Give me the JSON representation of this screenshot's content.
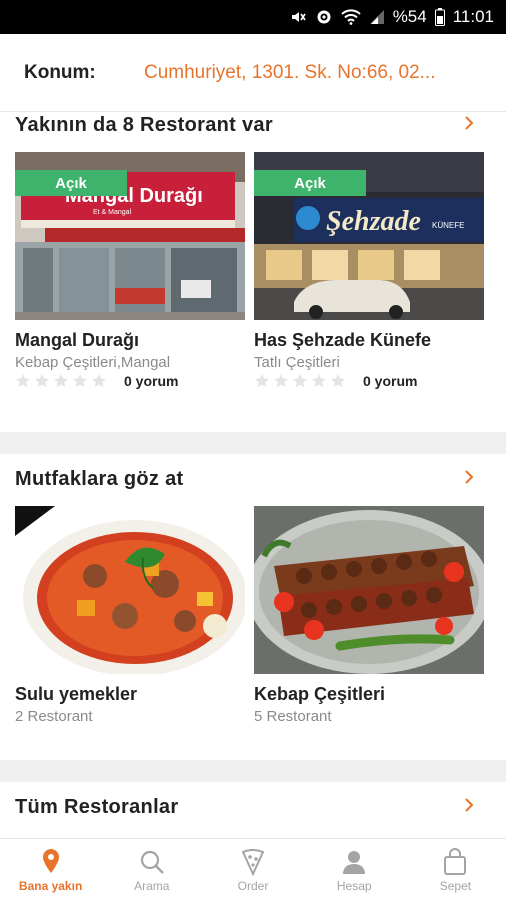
{
  "status_bar": {
    "battery": "%54",
    "time": "11:01"
  },
  "location": {
    "label": "Konum:",
    "value": "Cumhuriyet, 1301. Sk. No:66, 02..."
  },
  "nearby": {
    "title": "Yakının da 8 Restorant var",
    "restaurants": [
      {
        "status": "Açık",
        "name": "Mangal Durağı",
        "category": "Kebap Çeşitleri,Mangal",
        "reviews": "0 yorum",
        "rating": 0,
        "sign_text": "Mangal Durağı"
      },
      {
        "status": "Açık",
        "name": "Has Şehzade Künefe",
        "category": "Tatlı Çeşitleri",
        "reviews": "0 yorum",
        "rating": 0,
        "sign_text": "Şehzade"
      }
    ]
  },
  "cuisines": {
    "title": "Mutfaklara göz at",
    "items": [
      {
        "name": "Sulu yemekler",
        "count": "2 Restorant"
      },
      {
        "name": "Kebap Çeşitleri",
        "count": "5 Restorant"
      }
    ]
  },
  "all_restaurants": {
    "title": "Tüm Restoranlar"
  },
  "bottom_nav": [
    {
      "label": "Bana yakın",
      "icon": "location-pin-icon",
      "active": true
    },
    {
      "label": "Arama",
      "icon": "search-icon",
      "active": false
    },
    {
      "label": "Order",
      "icon": "pizza-slice-icon",
      "active": false
    },
    {
      "label": "Hesap",
      "icon": "user-icon",
      "active": false
    },
    {
      "label": "Sepet",
      "icon": "shopping-bag-icon",
      "active": false
    }
  ],
  "colors": {
    "accent": "#e8732c",
    "open_badge": "#3db36b",
    "muted": "#8a8a8a"
  }
}
